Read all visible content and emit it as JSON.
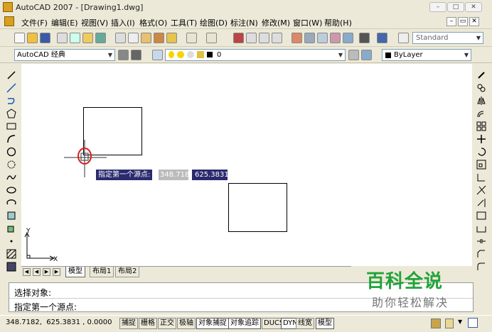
{
  "window": {
    "title": "AutoCAD 2007 - [Drawing1.dwg]"
  },
  "menu": [
    "文件(F)",
    "编辑(E)",
    "视图(V)",
    "插入(I)",
    "格式(O)",
    "工具(T)",
    "绘图(D)",
    "标注(N)",
    "修改(M)",
    "窗口(W)",
    "帮助(H)"
  ],
  "toolbar": {
    "text_style": "Standard"
  },
  "workspace": {
    "name": "AutoCAD 经典"
  },
  "layer": {
    "name": "0",
    "color_value": "ByLayer"
  },
  "tabs": [
    "模型",
    "布局1",
    "布局2"
  ],
  "tooltip": {
    "prompt": "指定第一个源点:",
    "x": "348.7182",
    "y": "625.3831"
  },
  "ucs": {
    "x_label": "X",
    "y_label": "Y"
  },
  "command": {
    "line1": "选择对象:",
    "line2": "指定第一个源点:"
  },
  "status": {
    "coords": "348.7182,  625.3831 , 0.0000",
    "buttons": [
      "捕捉",
      "栅格",
      "正交",
      "极轴",
      "对象捕捉",
      "对象追踪",
      "DUCS",
      "DYN",
      "线宽",
      "模型"
    ]
  },
  "watermark": {
    "logo": "百科全说",
    "sub": "助你轻松解决"
  },
  "colors": {
    "accent_red": "#d22020",
    "tooltip_bg": "#2a2a6e",
    "watermark_green": "#21a33a"
  }
}
